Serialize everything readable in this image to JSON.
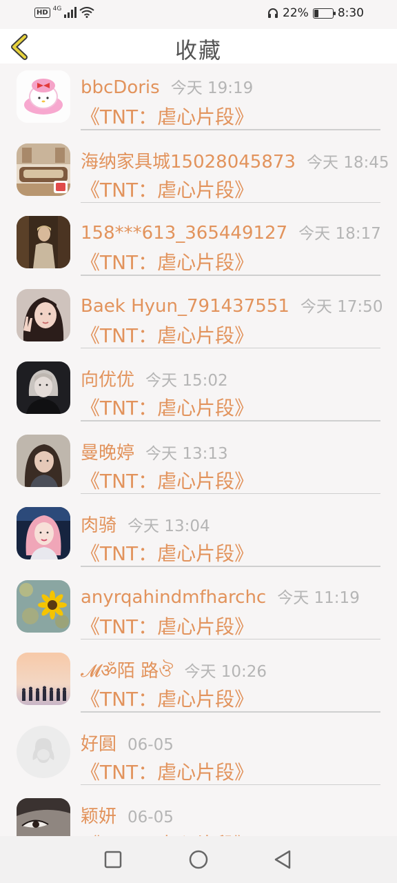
{
  "status_bar": {
    "hd": "HD",
    "network": "4G",
    "battery_percent": "22%",
    "battery_level": 0.22,
    "time": "8:30"
  },
  "header": {
    "title": "收藏"
  },
  "items": [
    {
      "name": "bbcDoris",
      "time": "今天 19:19",
      "subject": "《TNT：虐心片段》",
      "avatar": "my-melody-avatar"
    },
    {
      "name": "海纳家具城15028045873",
      "time": "今天 18:45",
      "subject": "《TNT：虐心片段》",
      "avatar": "furniture-avatar"
    },
    {
      "name": "158***613_365449127",
      "time": "今天 18:17",
      "subject": "《TNT：虐心片段》",
      "avatar": "person-avatar"
    },
    {
      "name": "Baek Hyun_791437551",
      "time": "今天 17:50",
      "subject": "《TNT：虐心片段》",
      "avatar": "girl-peace-avatar"
    },
    {
      "name": "向优优",
      "time": "今天 15:02",
      "subject": "《TNT：虐心片段》",
      "avatar": "dark-portrait-avatar"
    },
    {
      "name": "曼晚婷",
      "time": "今天 13:13",
      "subject": "《TNT：虐心片段》",
      "avatar": "girl-avatar"
    },
    {
      "name": "肉骑",
      "time": "今天 13:04",
      "subject": "《TNT：虐心片段》",
      "avatar": "pink-hair-avatar"
    },
    {
      "name": "anyrqahindmfharchc",
      "time": "今天 11:19",
      "subject": "《TNT：虐心片段》",
      "avatar": "sunflower-avatar"
    },
    {
      "name": "𝓜ॐ陌 路ঔ",
      "time": "今天 10:26",
      "subject": "《TNT：虐心片段》",
      "avatar": "sunset-group-avatar"
    },
    {
      "name": "好圓",
      "time": "06-05",
      "subject": "《TNT：虐心片段》",
      "avatar": "default-penguin-avatar"
    },
    {
      "name": "颖妍",
      "time": "06-05",
      "subject": "《TNT：虐心片段》",
      "avatar": "eye-closeup-avatar"
    }
  ],
  "nav_bar": {
    "icons": [
      "square-recents-icon",
      "circle-home-icon",
      "triangle-back-icon"
    ]
  }
}
